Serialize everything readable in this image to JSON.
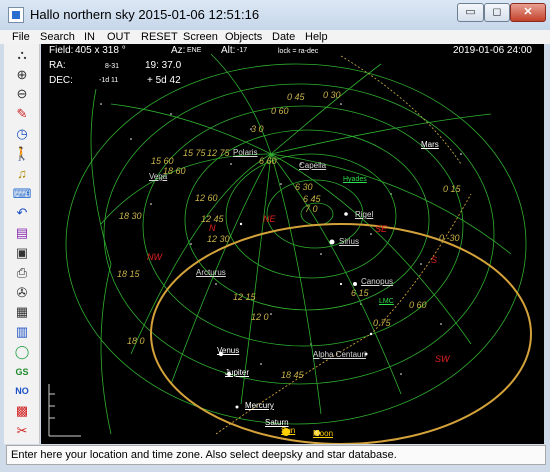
{
  "window": {
    "title": "Hallo northern sky   2015-01-06  12:51:16",
    "controls": {
      "minimize": "▭",
      "maximize": "◻",
      "close": "✕"
    }
  },
  "menu": [
    "File",
    "Search",
    "IN",
    "OUT",
    "RESET",
    "Screen",
    "Objects",
    "Date",
    "Help"
  ],
  "toolbar": [
    {
      "icon": "binoculars-icon",
      "glyph": "⛬"
    },
    {
      "icon": "zoom-in-icon",
      "glyph": "⊕"
    },
    {
      "icon": "zoom-out-icon",
      "glyph": "⊖"
    },
    {
      "icon": "pen-icon",
      "glyph": "✎"
    },
    {
      "icon": "clock-icon",
      "glyph": "◷"
    },
    {
      "icon": "walker-icon",
      "glyph": "🚶"
    },
    {
      "icon": "bell-icon",
      "glyph": "♫"
    },
    {
      "icon": "keyboard-icon",
      "glyph": "⌨"
    },
    {
      "icon": "undo-icon",
      "glyph": "↶"
    },
    {
      "icon": "books-icon",
      "glyph": "▤"
    },
    {
      "icon": "save-icon",
      "glyph": "▣"
    },
    {
      "icon": "print-icon",
      "glyph": "⎙"
    },
    {
      "icon": "wrench-icon",
      "glyph": "✇"
    },
    {
      "icon": "film-icon",
      "glyph": "▦"
    },
    {
      "icon": "calendar-icon",
      "glyph": "▥"
    },
    {
      "icon": "ring-icon",
      "glyph": "◯"
    },
    {
      "icon": "gs-icon",
      "glyph": "GS"
    },
    {
      "icon": "no-icon",
      "glyph": "NO"
    },
    {
      "icon": "grid-icon",
      "glyph": "▩"
    },
    {
      "icon": "scissors-icon",
      "glyph": "✂"
    }
  ],
  "sky": {
    "field_label": "Field:",
    "field_value": "405 x 318 °",
    "az_label": "Az:",
    "az_value": "ENE",
    "alt_label": "Alt:",
    "alt_value": "-17",
    "lock": "lock = ra-dec",
    "datetime": "2019-01-06  24:00",
    "ra_label": "RA:",
    "ra_small": "8-31",
    "ra_value": "19: 37.0",
    "dec_label": "DEC:",
    "dec_small": "-1d 11",
    "dec_value": "+ 5d 42",
    "stars": [
      "Polaris",
      "Capella",
      "Vega",
      "Rigel",
      "Sirius",
      "Arcturus",
      "Canopus",
      "Alpha Centauri"
    ],
    "planets": [
      "Mars",
      "Venus",
      "Jupiter",
      "Mercury",
      "Saturn",
      "Sun"
    ],
    "moon": "Moon",
    "deepsky": [
      "Hyades",
      "LMC"
    ],
    "directions": [
      "NE",
      "SE",
      "NW",
      "N",
      "S",
      "SW"
    ],
    "grid_labels": [
      "0 30",
      "0 45",
      "0 60",
      "3 0",
      "6 30",
      "6 45",
      "6 60",
      "12 60",
      "12 75",
      "12 45",
      "12 30",
      "12 15",
      "15 60",
      "15 75",
      "18 60",
      "18 30",
      "18 15",
      "18 45",
      "18 0",
      "0 15",
      "0 -30",
      "0 75",
      "0 60",
      "7 0",
      "6 15",
      "12 0"
    ]
  },
  "status": "Enter here your location and time zone. Also select deepsky and star database."
}
